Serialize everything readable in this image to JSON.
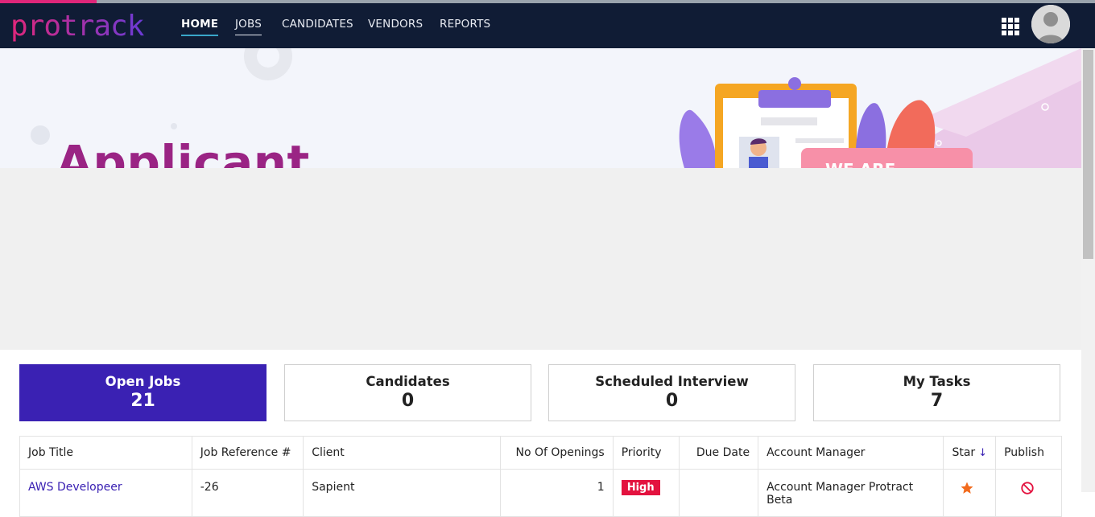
{
  "app": {
    "brand": "Protrack"
  },
  "nav": {
    "items": [
      {
        "label": "HOME",
        "active": true
      },
      {
        "label": "JOBS"
      },
      {
        "label": "CANDIDATES"
      },
      {
        "label": "VENDORS"
      },
      {
        "label": "REPORTS"
      }
    ]
  },
  "hero": {
    "title": "Applicant",
    "badge_text": "WE ARE"
  },
  "stats": [
    {
      "label": "Open Jobs",
      "value": "21",
      "active": true
    },
    {
      "label": "Candidates",
      "value": "0"
    },
    {
      "label": "Scheduled Interview",
      "value": "0"
    },
    {
      "label": "My Tasks",
      "value": "7"
    }
  ],
  "table": {
    "headers": [
      "Job Title",
      "Job Reference #",
      "Client",
      "No Of Openings",
      "Priority",
      "Due Date",
      "Account Manager",
      "Star",
      "Publish"
    ],
    "sorted_by": "Star",
    "rows": [
      {
        "job_title": "AWS Developeer",
        "job_reference": "-26",
        "client": "Sapient",
        "openings": "1",
        "priority": "High",
        "due_date": "",
        "account_manager": "Account Manager Protract Beta"
      }
    ]
  },
  "colors": {
    "nav_bg": "#101c35",
    "accent": "#3a21b3",
    "priority_high": "#e3123f",
    "brand_pink": "#e0267a"
  }
}
